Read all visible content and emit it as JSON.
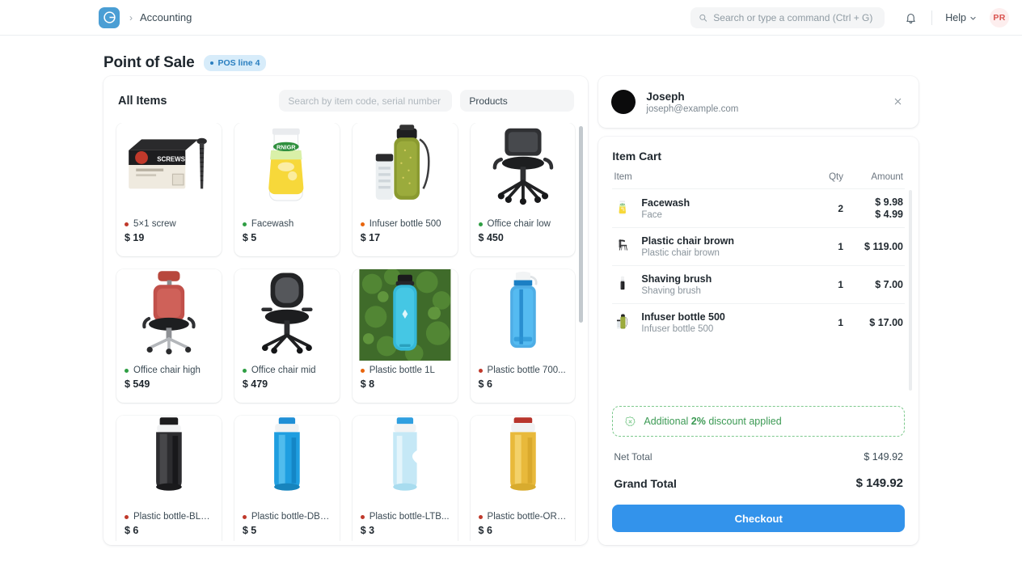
{
  "navbar": {
    "logo_icon": "frappe-logo-icon",
    "breadcrumb_separator": "›",
    "breadcrumb_label": "Accounting",
    "search_placeholder": "Search or type a command (Ctrl + G)",
    "search_value": "",
    "search_icon": "search-icon",
    "notification_icon": "bell-icon",
    "help_label": "Help",
    "help_caret_icon": "chevron-down-icon",
    "avatar_initials": "PR"
  },
  "page": {
    "title": "Point of Sale",
    "badge_label": "POS line 4",
    "menu_icon": "ellipsis-icon"
  },
  "items_panel": {
    "title": "All Items",
    "search_placeholder": "Search by item code, serial number or bar",
    "search_value": "",
    "filter_value": "Products",
    "products": [
      {
        "name": "5×1 screw",
        "price": "$ 19",
        "dot": "#c0392b",
        "art": "screw-box"
      },
      {
        "name": "Facewash",
        "price": "$ 5",
        "dot": "#2f9e44",
        "art": "facewash-tube"
      },
      {
        "name": "Infuser bottle 500",
        "price": "$ 17",
        "dot": "#e8650d",
        "art": "infuser-bottle"
      },
      {
        "name": "Office chair low",
        "price": "$ 450",
        "dot": "#2f9e44",
        "art": "chair-black"
      },
      {
        "name": "Office chair high",
        "price": "$ 549",
        "dot": "#2f9e44",
        "art": "chair-red"
      },
      {
        "name": "Office chair mid",
        "price": "$ 479",
        "dot": "#2f9e44",
        "art": "chair-mesh"
      },
      {
        "name": "Plastic bottle 1L",
        "price": "$ 8",
        "dot": "#e8650d",
        "art": "bottle-teal-outdoor"
      },
      {
        "name": "Plastic bottle 700...",
        "price": "$ 6",
        "dot": "#c0392b",
        "art": "bottle-blue-sport"
      },
      {
        "name": "Plastic bottle-BLK...",
        "price": "$ 6",
        "dot": "#c0392b",
        "art": "bottle-black"
      },
      {
        "name": "Plastic bottle-DBL...",
        "price": "$ 5",
        "dot": "#c0392b",
        "art": "bottle-darkblue"
      },
      {
        "name": "Plastic bottle-LTB...",
        "price": "$ 3",
        "dot": "#c0392b",
        "art": "bottle-lightblue"
      },
      {
        "name": "Plastic bottle-ORG...",
        "price": "$ 6",
        "dot": "#c0392b",
        "art": "bottle-orange"
      }
    ]
  },
  "customer": {
    "name": "Joseph",
    "email": "joseph@example.com",
    "close_icon": "close-icon"
  },
  "cart": {
    "title": "Item Cart",
    "columns": {
      "item": "Item",
      "qty": "Qty",
      "amount": "Amount"
    },
    "rows": [
      {
        "name": "Facewash",
        "desc": "Face",
        "qty": "2",
        "amount": "$ 9.98",
        "rate": "$ 4.99",
        "art": "facewash-tube"
      },
      {
        "name": "Plastic chair brown",
        "desc": "Plastic chair brown",
        "qty": "1",
        "amount": "$ 119.00",
        "rate": "",
        "art": "chair-brown"
      },
      {
        "name": "Shaving brush",
        "desc": "Shaving brush",
        "qty": "1",
        "amount": "$ 7.00",
        "rate": "",
        "art": "shaving-brush"
      },
      {
        "name": "Infuser bottle 500",
        "desc": "Infuser bottle 500",
        "qty": "1",
        "amount": "$ 17.00",
        "rate": "",
        "art": "infuser-bottle"
      }
    ],
    "discount_icon": "discount-badge-icon",
    "discount_prefix": "Additional ",
    "discount_percent": "2%",
    "discount_suffix": " discount applied",
    "net_total_label": "Net Total",
    "net_total_value": "$ 149.92",
    "grand_total_label": "Grand Total",
    "grand_total_value": "$ 149.92",
    "checkout_label": "Checkout"
  },
  "colors": {
    "accent_blue": "#3393eb",
    "badge_blue": "#2a7fc0",
    "success_green": "#3c9a54"
  }
}
